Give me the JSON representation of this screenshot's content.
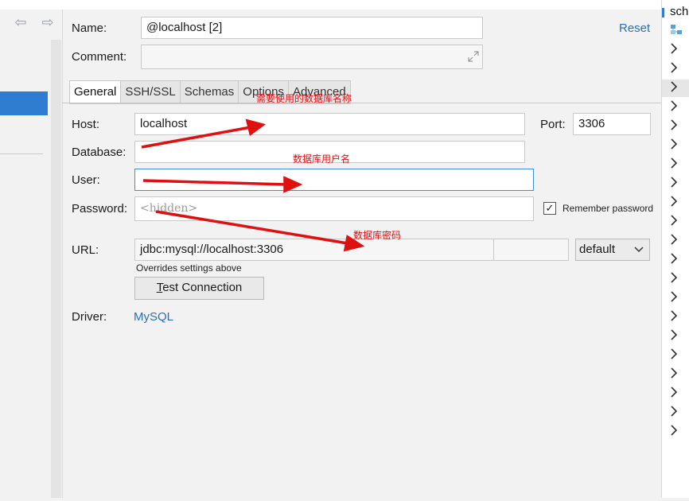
{
  "form": {
    "name_label": "Name:",
    "name_value": "@localhost [2]",
    "comment_label": "Comment:",
    "comment_value": "",
    "reset_label": "Reset"
  },
  "tabs": [
    {
      "label": "General",
      "active": true
    },
    {
      "label": "SSH/SSL",
      "active": false
    },
    {
      "label": "Schemas",
      "active": false
    },
    {
      "label": "Options",
      "active": false
    },
    {
      "label": "Advanced",
      "active": false
    }
  ],
  "general": {
    "host_label": "Host:",
    "host_value": "localhost",
    "port_label": "Port:",
    "port_value": "3306",
    "database_label": "Database:",
    "database_value": "",
    "user_label": "User:",
    "user_value": "",
    "password_label": "Password:",
    "password_placeholder": "<hidden>",
    "remember_label": "Remember password",
    "remember_checked": "✓",
    "url_label": "URL:",
    "url_value": "jdbc:mysql://localhost:3306",
    "url_mode": "default",
    "url_hint": "Overrides settings above",
    "test_button_prefix": "T",
    "test_button_rest": "est Connection",
    "driver_label": "Driver:",
    "driver_value": "MySQL"
  },
  "annotations": {
    "db_name": "需要使用的数据库名称",
    "db_user": "数据库用户名",
    "db_password": "数据库密码"
  },
  "right_panel": {
    "title": "sch"
  },
  "colors": {
    "accent": "#2f7dd1",
    "link": "#2a6fb2",
    "annotation": "#e01010",
    "panel_bg": "#f2f2f2"
  }
}
